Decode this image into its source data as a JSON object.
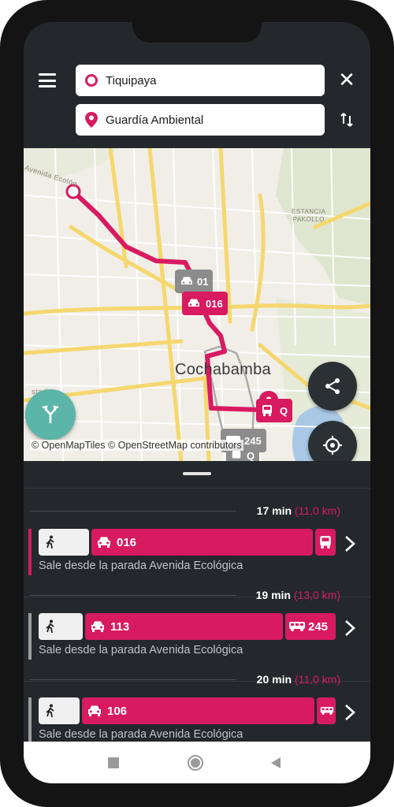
{
  "search": {
    "origin": "Tiquipaya",
    "destination": "Guardía Ambiental"
  },
  "map": {
    "city_label": "Cochabamba",
    "area_label_line1": "ESTANCIA",
    "area_label_line2": "PAKOLLO",
    "street_label_1": "Avenida Ecológ",
    "street_label_2": "stariz",
    "attribution": "© OpenMapTiles © OpenStreetMap contributors",
    "chips": [
      {
        "label": "016",
        "state": "active"
      },
      {
        "label": "01",
        "state": "inactive"
      },
      {
        "label": "Q",
        "state": "active"
      },
      {
        "label": "245",
        "state": "inactive"
      },
      {
        "label": "Q",
        "state": "inactive"
      }
    ]
  },
  "routes": [
    {
      "duration": "17 min",
      "distance": "(11,0 km)",
      "line": "016",
      "transfer": "",
      "description": "Sale desde la parada Avenida Ecológica",
      "selected": true
    },
    {
      "duration": "19 min",
      "distance": "(13,0 km)",
      "line": "113",
      "transfer": "245",
      "description": "Sale desde la parada Avenida Ecológica",
      "selected": false
    },
    {
      "duration": "20 min",
      "distance": "(11,0 km)",
      "line": "106",
      "transfer": "",
      "description": "Sale desde la parada Avenida Ecológica",
      "selected": false
    }
  ],
  "colors": {
    "accent": "#d81b60",
    "sheet_bg": "#24282d",
    "fab_teal": "#5bb5a8",
    "unselected_bar": "#9e9e9e"
  },
  "icons": [
    "menu-icon",
    "close-icon",
    "swap-icon",
    "origin-icon",
    "destination-pin-icon",
    "share-icon",
    "locate-icon",
    "route-fork-icon",
    "walk-icon",
    "taxi-icon",
    "bus-icon",
    "chevron-right-icon"
  ]
}
